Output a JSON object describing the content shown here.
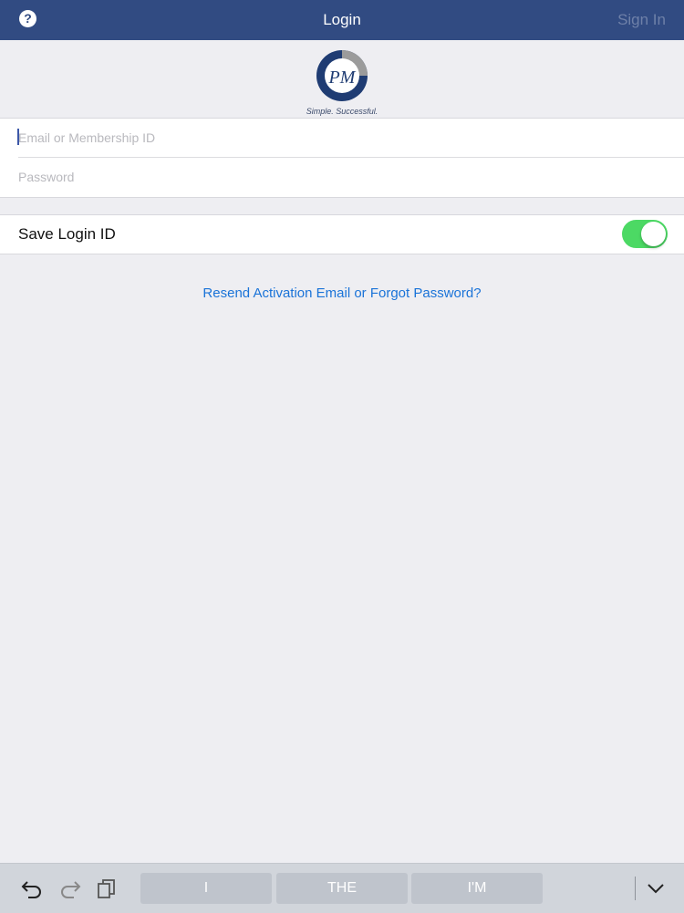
{
  "navbar": {
    "help_icon": "question-circle-icon",
    "help_glyph": "?",
    "title": "Login",
    "sign_in_label": "Sign In"
  },
  "logo": {
    "monogram": "PM",
    "tagline": "Simple. Successful."
  },
  "form": {
    "email_placeholder": "Email or Membership ID",
    "email_value": "",
    "password_placeholder": "Password",
    "password_value": ""
  },
  "save_login": {
    "label": "Save Login ID",
    "enabled": true
  },
  "resend_link": "Resend Activation Email or Forgot Password?",
  "keyboard_bar": {
    "icons": [
      "undo-icon",
      "redo-icon",
      "paste-icon",
      "keyboard-dismiss-icon"
    ],
    "suggestions": [
      "I",
      "THE",
      "I'M"
    ]
  },
  "colors": {
    "navbar": "#314b82",
    "switch_on": "#4cd964",
    "link": "#1a73d8",
    "background": "#eeeef2"
  }
}
